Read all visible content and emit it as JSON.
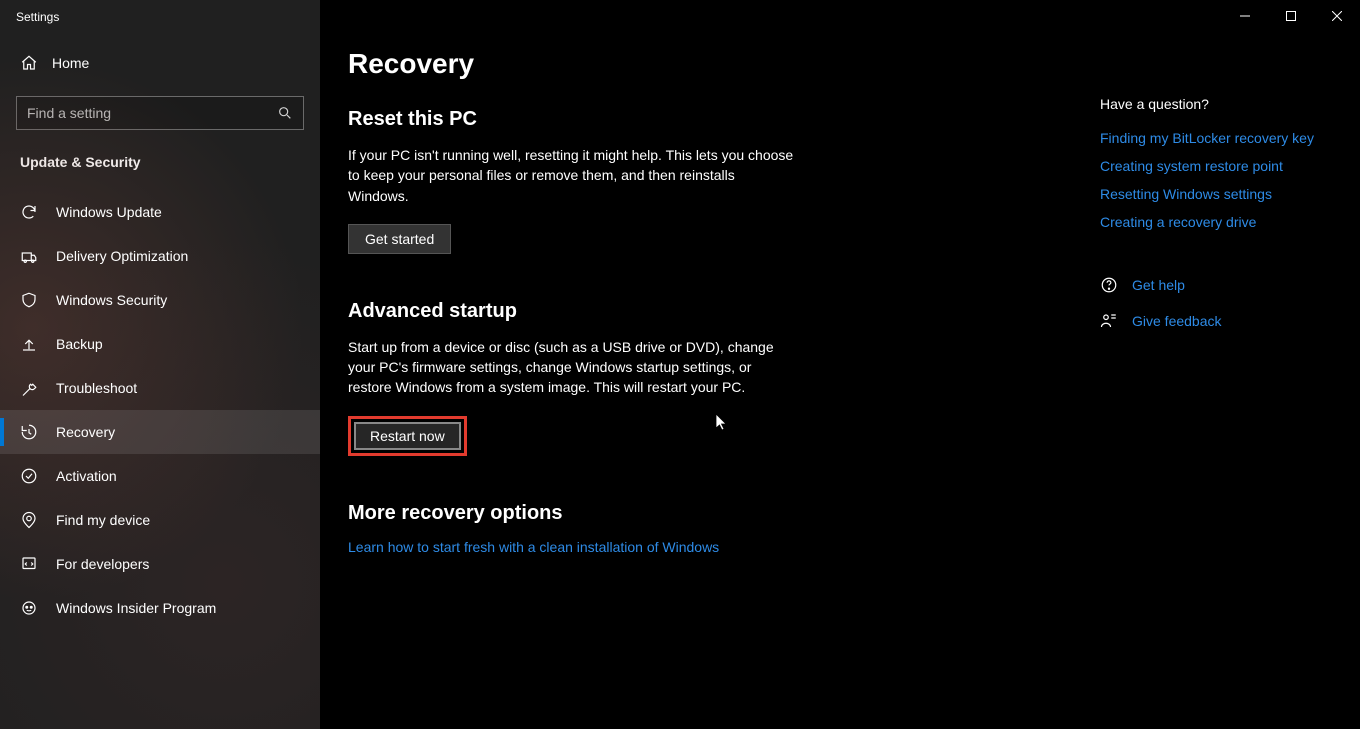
{
  "window": {
    "title": "Settings"
  },
  "sidebar": {
    "home": "Home",
    "search_placeholder": "Find a setting",
    "section": "Update & Security",
    "items": [
      {
        "label": "Windows Update"
      },
      {
        "label": "Delivery Optimization"
      },
      {
        "label": "Windows Security"
      },
      {
        "label": "Backup"
      },
      {
        "label": "Troubleshoot"
      },
      {
        "label": "Recovery"
      },
      {
        "label": "Activation"
      },
      {
        "label": "Find my device"
      },
      {
        "label": "For developers"
      },
      {
        "label": "Windows Insider Program"
      }
    ]
  },
  "page": {
    "title": "Recovery",
    "reset": {
      "title": "Reset this PC",
      "desc": "If your PC isn't running well, resetting it might help. This lets you choose to keep your personal files or remove them, and then reinstalls Windows.",
      "button": "Get started"
    },
    "advanced": {
      "title": "Advanced startup",
      "desc": "Start up from a device or disc (such as a USB drive or DVD), change your PC's firmware settings, change Windows startup settings, or restore Windows from a system image. This will restart your PC.",
      "button": "Restart now"
    },
    "more": {
      "title": "More recovery options",
      "link": "Learn how to start fresh with a clean installation of Windows"
    }
  },
  "right": {
    "question": "Have a question?",
    "links": [
      "Finding my BitLocker recovery key",
      "Creating system restore point",
      "Resetting Windows settings",
      "Creating a recovery drive"
    ],
    "get_help": "Get help",
    "give_feedback": "Give feedback"
  }
}
